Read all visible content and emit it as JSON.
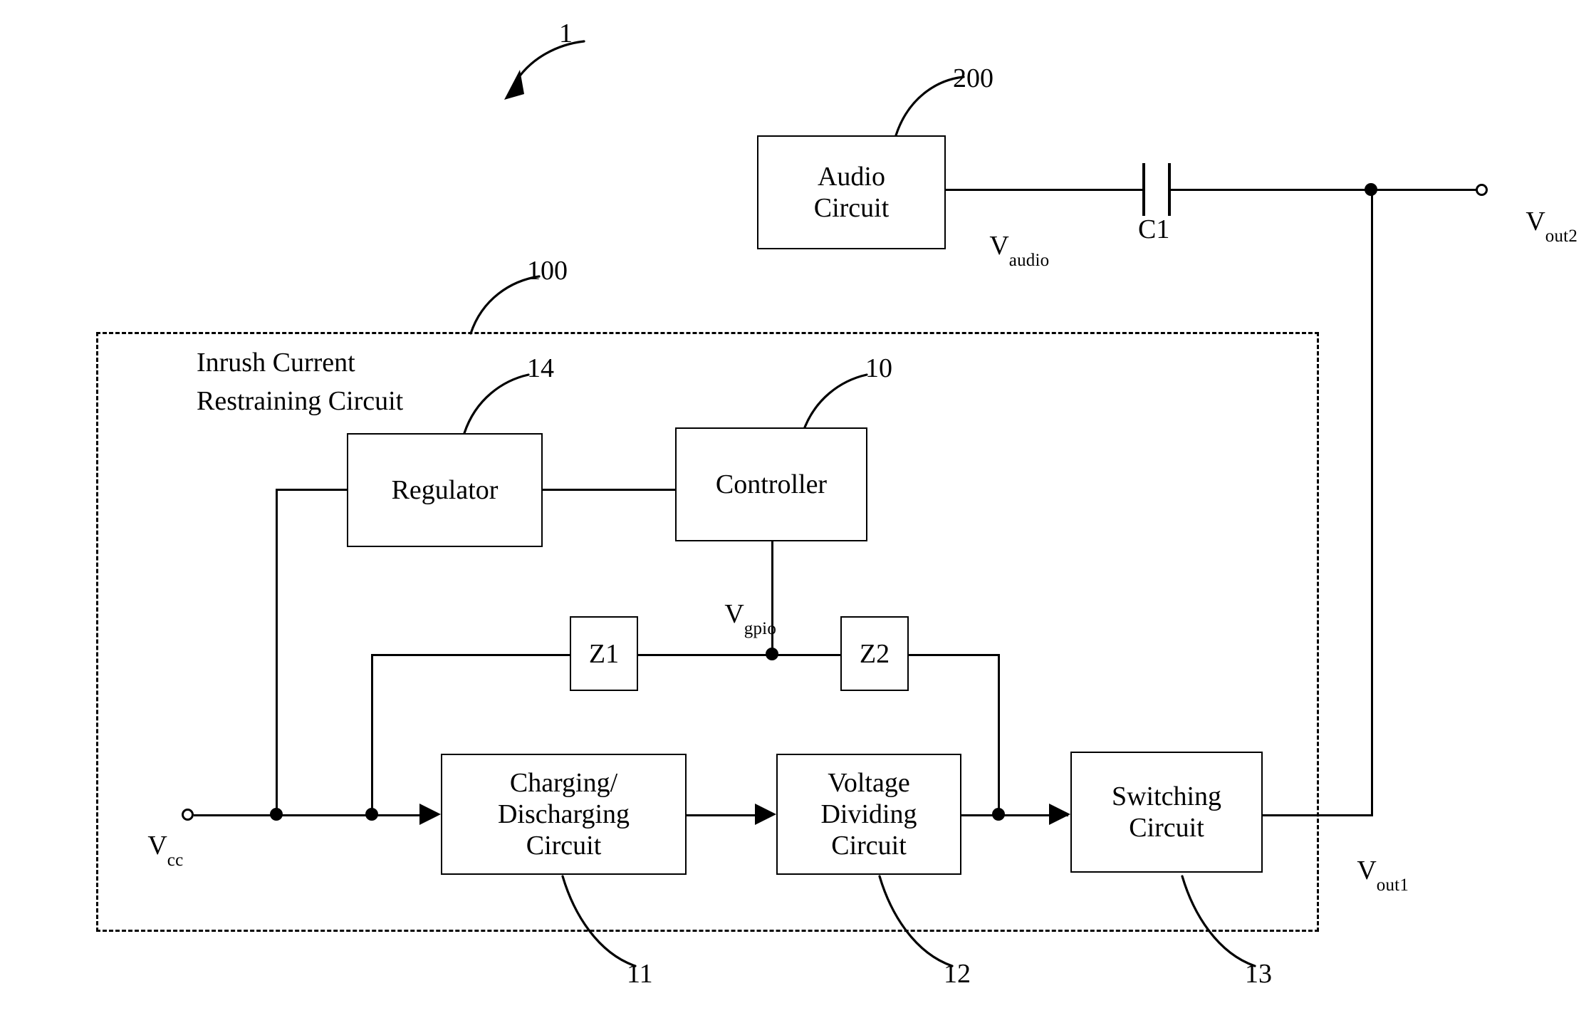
{
  "figure": {
    "number": "1"
  },
  "reference_numerals": {
    "system": "1",
    "audio_circuit": "200",
    "inrush_circuit": "100",
    "regulator": "14",
    "controller": "10",
    "charging_discharging_circuit": "11",
    "voltage_dividing_circuit": "12",
    "switching_circuit": "13"
  },
  "blocks": {
    "audio_circuit": {
      "line1": "Audio",
      "line2": "Circuit"
    },
    "regulator": {
      "label": "Regulator"
    },
    "controller": {
      "label": "Controller"
    },
    "z1": {
      "label": "Z1"
    },
    "z2": {
      "label": "Z2"
    },
    "charging_discharging": {
      "line1": "Charging/",
      "line2": "Discharging",
      "line3": "Circuit"
    },
    "voltage_dividing": {
      "line1": "Voltage",
      "line2": "Dividing",
      "line3": "Circuit"
    },
    "switching": {
      "line1": "Switching",
      "line2": "Circuit"
    }
  },
  "enclosure": {
    "title_line1": "Inrush Current",
    "title_line2": "Restraining Circuit"
  },
  "signals": {
    "v_audio": {
      "base": "V",
      "sub": "audio"
    },
    "v_out2": {
      "base": "V",
      "sub": "out2"
    },
    "v_out1": {
      "base": "V",
      "sub": "out1"
    },
    "v_cc": {
      "base": "V",
      "sub": "cc"
    },
    "v_gpio": {
      "base": "V",
      "sub": "gpio"
    }
  },
  "components": {
    "capacitor_c1": "C1"
  },
  "colors": {
    "ink": "#000000",
    "paper": "#ffffff"
  }
}
